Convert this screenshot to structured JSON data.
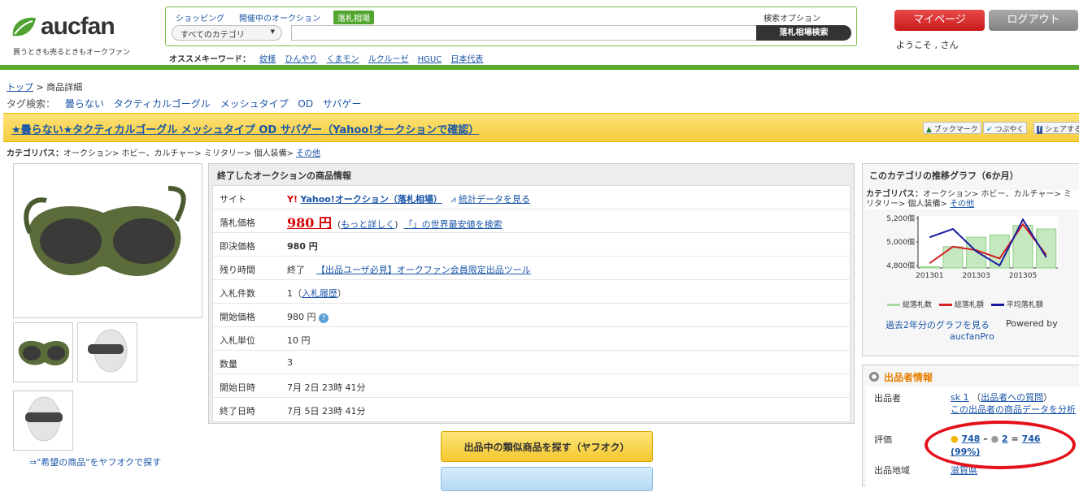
{
  "header": {
    "logo_text": "aucfan",
    "logo_tagline": "買うときも売るときもオークファン",
    "search_tabs": [
      "ショッピング",
      "開催中のオークション",
      "落札相場"
    ],
    "search_option": "検索オプション",
    "category_select": "すべてのカテゴリ",
    "search_button": "落札相場検索",
    "keywords_label": "オススメキーワード：",
    "keywords": [
      "紋様",
      "ひんやり",
      "くまモン",
      "ルクルーゼ",
      "HGUC",
      "日本代表"
    ],
    "mypage": "マイページ",
    "logout": "ログアウト",
    "welcome": "ようこそ ,   さん"
  },
  "breadcrumb": {
    "top": "トップ",
    "sep": " > ",
    "current": "商品詳細"
  },
  "tags": {
    "label": "タグ検索：",
    "items": [
      "曇らない",
      "タクティカルゴーグル",
      "メッシュタイプ",
      "OD",
      "サバゲー"
    ]
  },
  "title": "★曇らない★タクティカルゴーグル メッシュタイプ OD サバゲー（Yahoo!オークションで確認）",
  "social": [
    "ブックマーク",
    "つぶやく",
    "シェアする"
  ],
  "category_path": {
    "label": "カテゴリパス：",
    "path": "オークション> ホビー、カルチャー> ミリタリー> 個人装備> ",
    "last": "その他"
  },
  "wish_link": "⇒\"希望の商品\"をヤフオクで探す",
  "info": {
    "heading": "終了したオークションの商品情報",
    "site_label": "サイト",
    "site_value": "Yahoo!オークション（落札相場）",
    "stats_link": "統計データを見る",
    "price_label": "落札価格",
    "price_value": "980 円",
    "price_more": "もっと詳しく",
    "price_search": "「」の世界最安値を検索",
    "buyout_label": "即決価格",
    "buyout_value": "980 円",
    "remaining_label": "残り時間",
    "remaining_value": "終了",
    "remaining_link": "【出品ユーザ必見】オークファン会員限定出品ツール",
    "bids_label": "入札件数",
    "bids_value": "1",
    "bids_link": "入札履歴",
    "start_price_label": "開始価格",
    "start_price_value": "980 円",
    "increment_label": "入札単位",
    "increment_value": "10 円",
    "qty_label": "数量",
    "qty_value": "3",
    "start_label": "開始日時",
    "start_value": "7月 2日 23時 41分",
    "end_label": "終了日時",
    "end_value": "7月 5日 23時 41分"
  },
  "buttons": {
    "yahoo_similar": "出品中の類似商品を探す（ヤフオク）"
  },
  "graph": {
    "heading": "このカテゴリの推移グラフ（6か月）",
    "cat_label": "カテゴリパス：",
    "cat_path": "オークション> ホビー、カルチャー> ミリタリー> 個人装備>",
    "cat_last": "その他",
    "legend": [
      "総落札数",
      "総落札額",
      "平均落札額"
    ],
    "past_link": "過去2年分のグラフを見る",
    "powered": "Powered by",
    "powered_brand": "aucfanPro",
    "colors": {
      "bars": "#c5e8c0",
      "total": "#d42020",
      "avg": "#1a1aa0"
    }
  },
  "chart_data": {
    "type": "bar",
    "categories": [
      "201301",
      "201302",
      "201303",
      "201304",
      "201305",
      "201306"
    ],
    "tick_labels": [
      "201301",
      "201303",
      "201305"
    ],
    "yticks": [
      "5,200個",
      "5,000個",
      "4,800個"
    ],
    "ylim": [
      4780,
      5220
    ],
    "series": [
      {
        "name": "総落札数",
        "values": [
          4790,
          4960,
          5040,
          5060,
          5140,
          5110
        ]
      },
      {
        "name": "総落札額",
        "values": [
          4820,
          4960,
          4930,
          4860,
          5150,
          4890
        ]
      },
      {
        "name": "平均落札額",
        "values": [
          5040,
          5110,
          4920,
          4800,
          5190,
          4870
        ]
      }
    ]
  },
  "seller": {
    "heading": "出品者情報",
    "seller_label": "出品者",
    "seller_name": "sk      1",
    "question_link": "出品者への質問",
    "data_link": "この出品者の商品データを分析",
    "rating_label": "評価",
    "good": "748",
    "bad": "2",
    "total": "746",
    "pct": "(99%)",
    "region_label": "出品地域",
    "region": "滋賀県"
  }
}
